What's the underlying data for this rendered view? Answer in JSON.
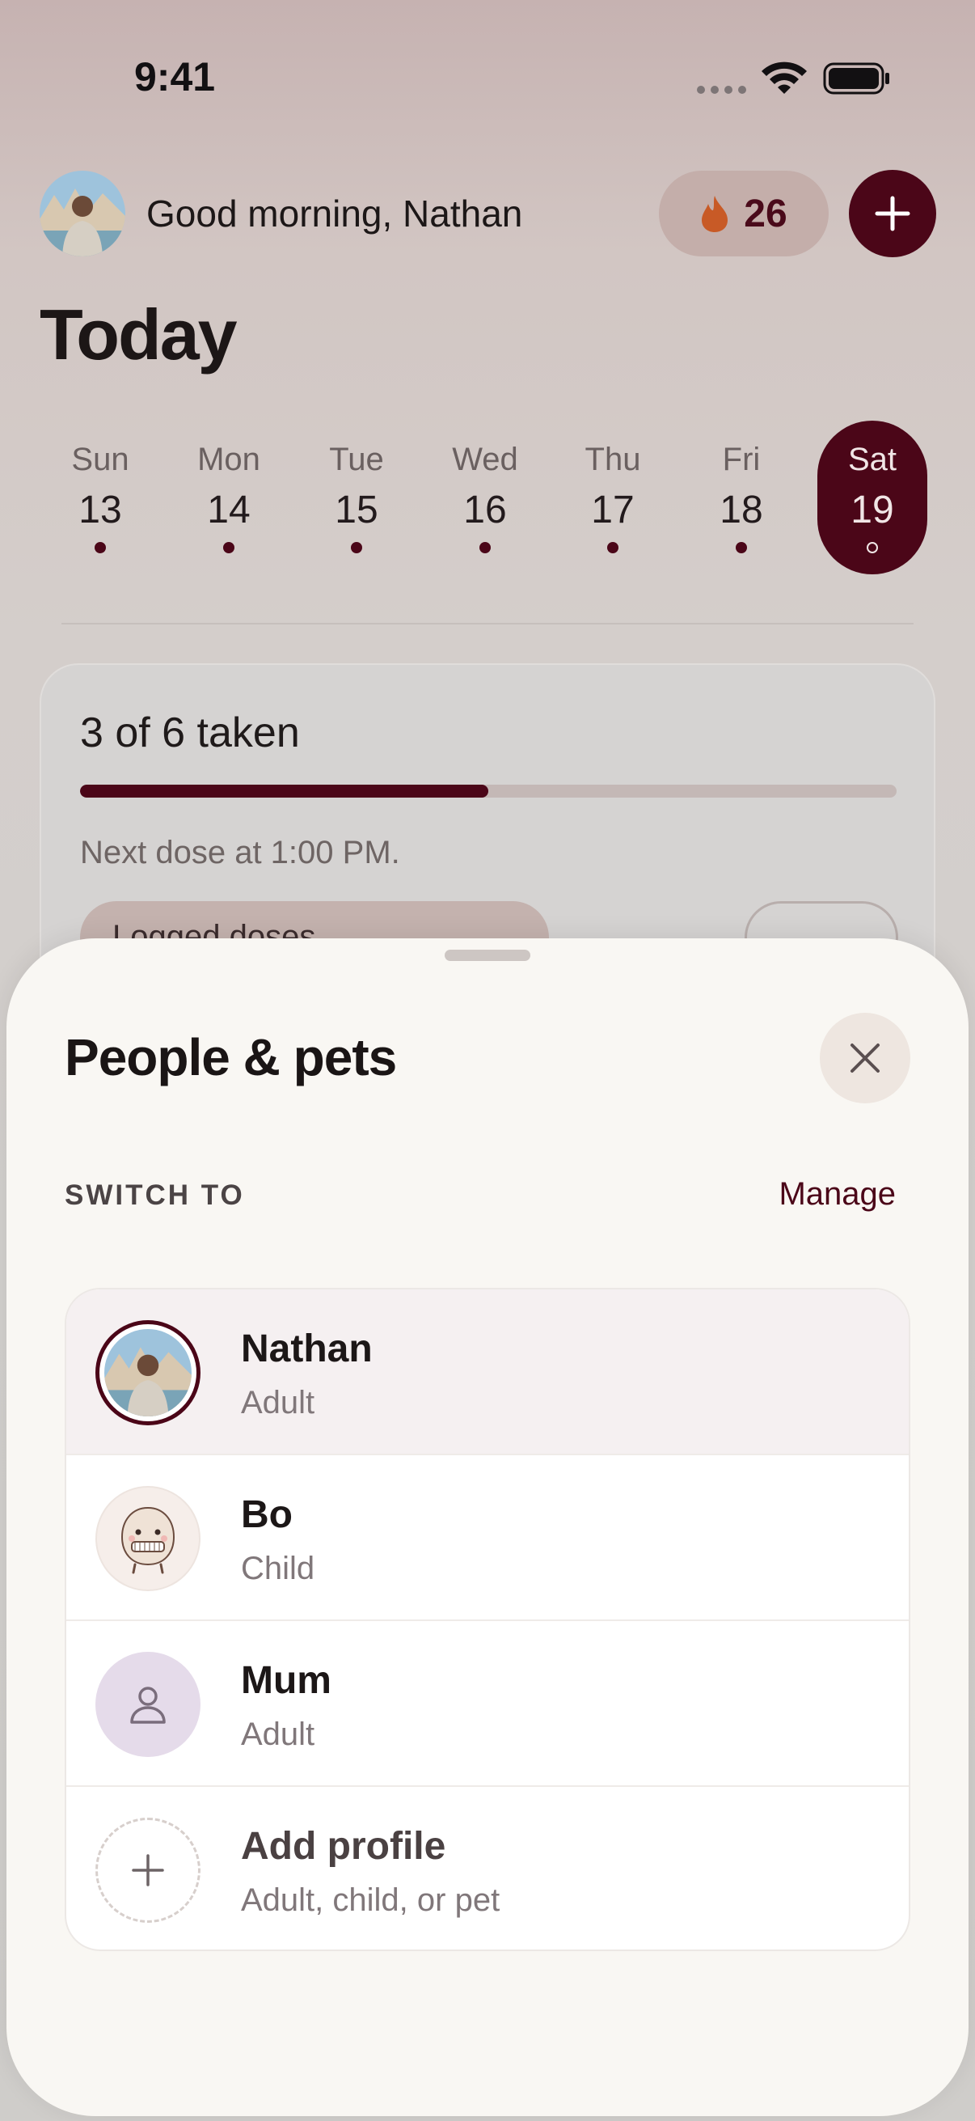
{
  "status_bar": {
    "time": "9:41"
  },
  "header": {
    "greeting": "Good morning, Nathan",
    "streak_count": "26",
    "streak_icon": "flame-icon",
    "add_icon": "plus-icon"
  },
  "page": {
    "title": "Today"
  },
  "week": {
    "days": [
      {
        "name": "Sun",
        "num": "13"
      },
      {
        "name": "Mon",
        "num": "14"
      },
      {
        "name": "Tue",
        "num": "15"
      },
      {
        "name": "Wed",
        "num": "16"
      },
      {
        "name": "Thu",
        "num": "17"
      },
      {
        "name": "Fri",
        "num": "18"
      },
      {
        "name": "Sat",
        "num": "19"
      }
    ],
    "selected": "Sat"
  },
  "progress": {
    "title": "3 of 6 taken",
    "taken": 3,
    "total": 6,
    "next_dose": "Next dose at 1:00 PM.",
    "logged_label": "Logged doses"
  },
  "sheet": {
    "title": "People & pets",
    "switch_label": "SWITCH TO",
    "manage_label": "Manage",
    "profiles": [
      {
        "name": "Nathan",
        "type": "Adult"
      },
      {
        "name": "Bo",
        "type": "Child"
      },
      {
        "name": "Mum",
        "type": "Adult"
      },
      {
        "name": "Add profile",
        "type": "Adult, child, or pet"
      }
    ]
  },
  "colors": {
    "accent": "#4b0618",
    "flame": "#c85a26",
    "sheet_bg": "#f9f7f3"
  }
}
